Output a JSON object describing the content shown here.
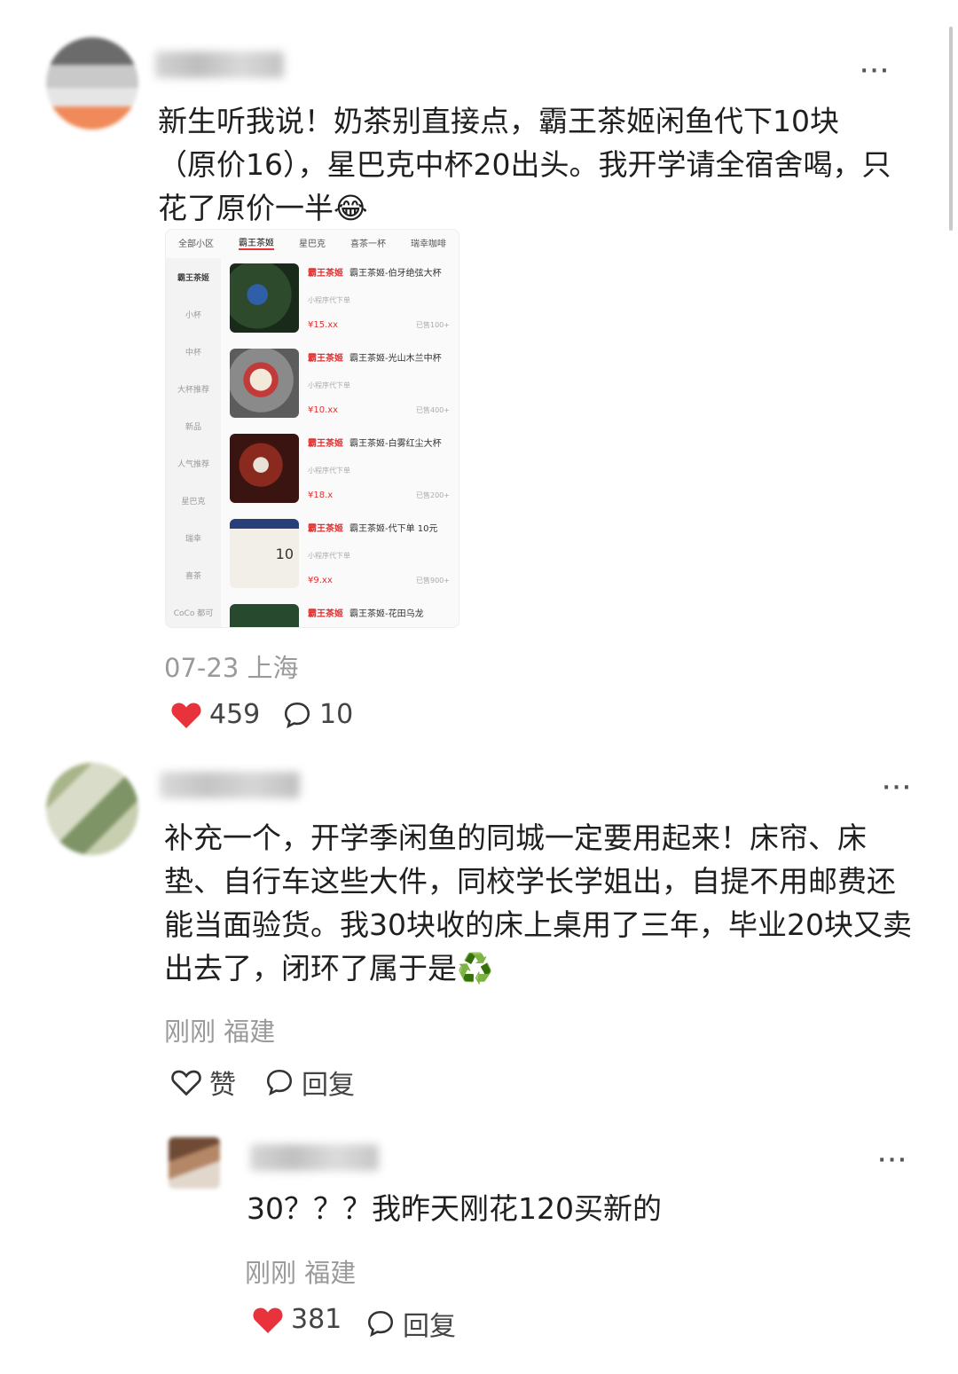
{
  "comments": [
    {
      "text": "新生听我说！奶茶别直接点，霸王茶姬闲鱼代下10块（原价16），星巴克中杯20出头。我开学请全宿舍喝，只花了原价一半😂",
      "meta": "07-23 上海",
      "likes": "459",
      "replies": "10"
    },
    {
      "text": "补充一个，开学季闲鱼的同城一定要用起来！床帘、床垫、自行车这些大件，同校学长学姐出，自提不用邮费还能当面验货。我30块收的床上桌用了三年，毕业20块又卖出去了，闭环了属于是♻️",
      "meta": "刚刚 福建",
      "like_label": "赞",
      "reply_label": "回复"
    },
    {
      "text": "30？？？我昨天刚花120买新的",
      "meta": "刚刚 福建",
      "likes": "381",
      "reply_label": "回复"
    }
  ],
  "embedded_screenshot": {
    "tabs": [
      "全部小区",
      "霸王茶姬",
      "星巴克",
      "喜茶一杯",
      "瑞幸咖啡"
    ],
    "sidebar": [
      "霸王茶姬",
      "小杯",
      "中杯",
      "大杯推荐",
      "新品",
      "人气推荐",
      "星巴克",
      "瑞幸",
      "喜茶",
      "CoCo 都可"
    ],
    "items": [
      {
        "brand": "霸王茶姬",
        "title": "霸王茶姬-伯牙绝弦大杯",
        "sub": "小程序代下单",
        "price": "¥15.xx",
        "sold": "已售100+",
        "tag": ""
      },
      {
        "brand": "霸王茶姬",
        "title": "霸王茶姬-光山木兰中杯",
        "sub": "小程序代下单",
        "price": "¥10.xx",
        "sold": "已售400+",
        "tag": ""
      },
      {
        "brand": "霸王茶姬",
        "title": "霸王茶姬-白雾红尘大杯",
        "sub": "小程序代下单",
        "price": "¥18.x",
        "sold": "已售200+",
        "tag": ""
      },
      {
        "brand": "霸王茶姬",
        "title": "霸王茶姬-代下单 10元",
        "sub": "小程序代下单",
        "price": "¥9.xx",
        "sold": "已售900+",
        "tag": "10"
      },
      {
        "brand": "霸王茶姬",
        "title": "霸王茶姬-花田乌龙",
        "sub": "",
        "price": "",
        "sold": "",
        "tag": ""
      }
    ]
  },
  "colors": {
    "like_red": "#e8323c",
    "meta_gray": "#9a9a9a",
    "text": "#1f1f1f"
  }
}
